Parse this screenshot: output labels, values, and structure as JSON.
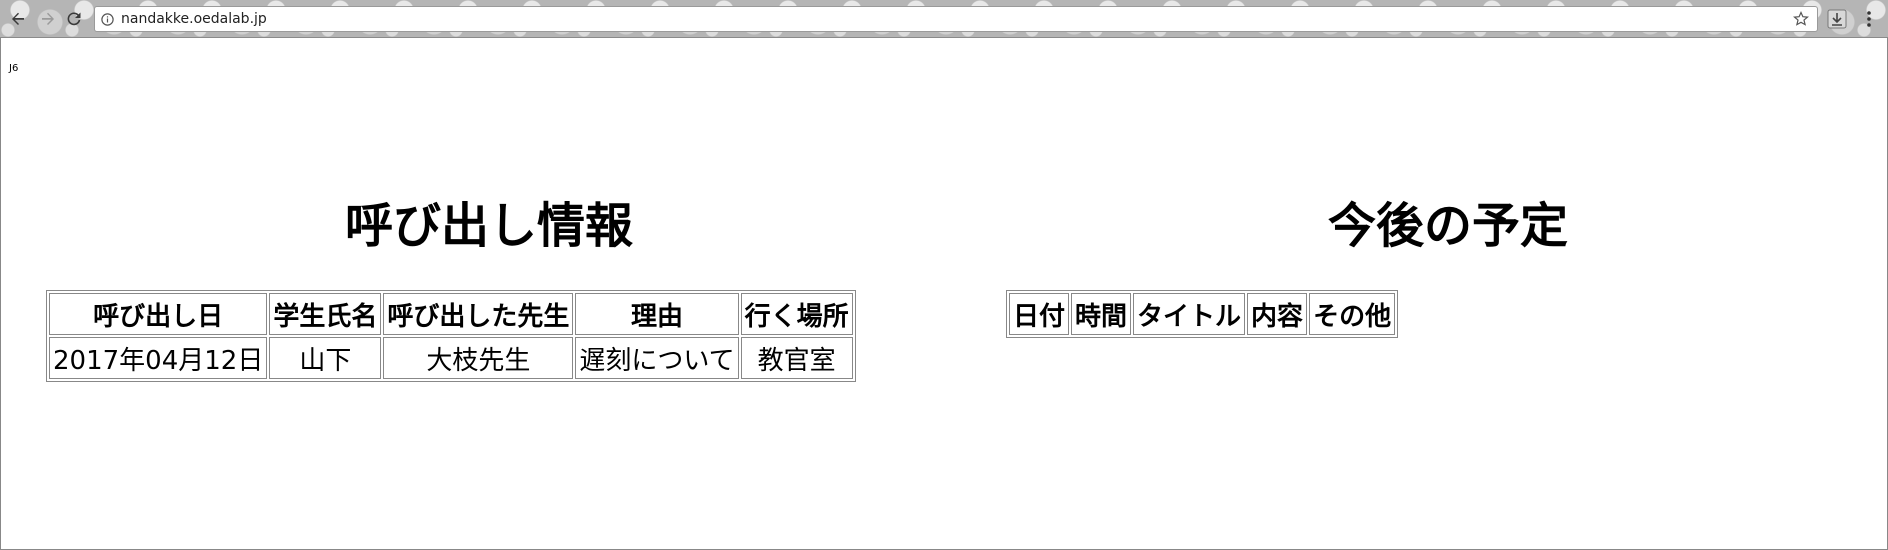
{
  "browser": {
    "url": "nandakke.oedalab.jp"
  },
  "page": {
    "corner_text": "J6",
    "call_section": {
      "title": "呼び出し情報",
      "headers": [
        "呼び出し日",
        "学生氏名",
        "呼び出した先生",
        "理由",
        "行く場所"
      ],
      "rows": [
        [
          "2017年04月12日",
          "山下",
          "大枝先生",
          "遅刻について",
          "教官室"
        ]
      ]
    },
    "schedule_section": {
      "title": "今後の予定",
      "headers": [
        "日付",
        "時間",
        "タイトル",
        "内容",
        "その他"
      ]
    }
  }
}
